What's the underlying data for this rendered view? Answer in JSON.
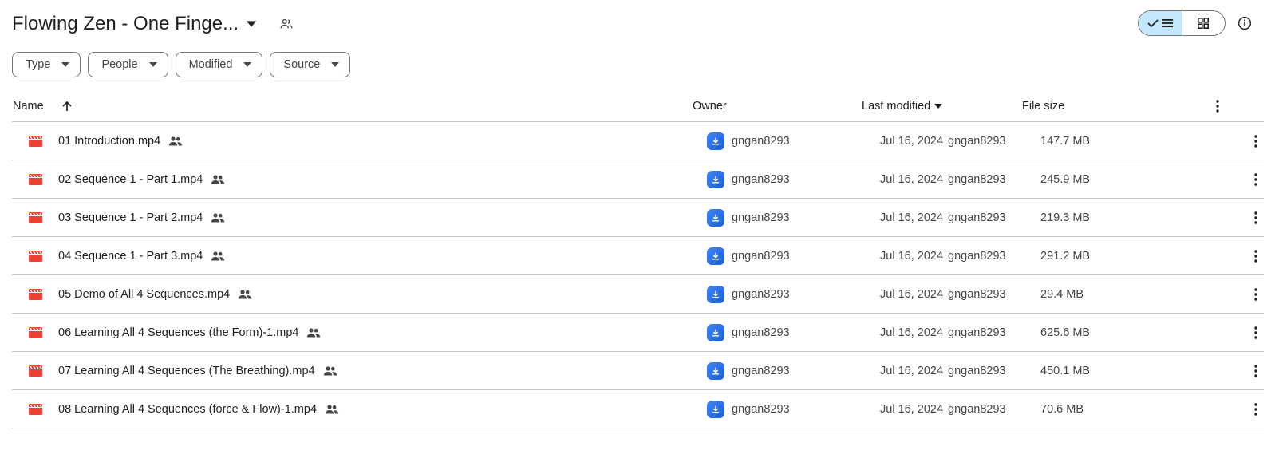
{
  "folder": {
    "title": "Flowing Zen - One Finge..."
  },
  "filters": [
    {
      "label": "Type"
    },
    {
      "label": "People"
    },
    {
      "label": "Modified"
    },
    {
      "label": "Source"
    }
  ],
  "table": {
    "columns": {
      "name": "Name",
      "owner": "Owner",
      "last_modified": "Last modified",
      "file_size": "File size"
    },
    "rows": [
      {
        "name": "01 Introduction.mp4",
        "owner": "gngan8293",
        "date": "Jul 16, 2024",
        "modified_by": "gngan8293",
        "size": "147.7 MB"
      },
      {
        "name": "02 Sequence 1 - Part 1.mp4",
        "owner": "gngan8293",
        "date": "Jul 16, 2024",
        "modified_by": "gngan8293",
        "size": "245.9 MB"
      },
      {
        "name": "03 Sequence 1 - Part 2.mp4",
        "owner": "gngan8293",
        "date": "Jul 16, 2024",
        "modified_by": "gngan8293",
        "size": "219.3 MB"
      },
      {
        "name": "04 Sequence 1 - Part 3.mp4",
        "owner": "gngan8293",
        "date": "Jul 16, 2024",
        "modified_by": "gngan8293",
        "size": "291.2 MB"
      },
      {
        "name": "05 Demo of All 4 Sequences.mp4",
        "owner": "gngan8293",
        "date": "Jul 16, 2024",
        "modified_by": "gngan8293",
        "size": "29.4 MB"
      },
      {
        "name": "06 Learning All 4 Sequences (the Form)-1.mp4",
        "owner": "gngan8293",
        "date": "Jul 16, 2024",
        "modified_by": "gngan8293",
        "size": "625.6 MB"
      },
      {
        "name": "07 Learning All 4 Sequences (The Breathing).mp4",
        "owner": "gngan8293",
        "date": "Jul 16, 2024",
        "modified_by": "gngan8293",
        "size": "450.1 MB"
      },
      {
        "name": "08 Learning All 4 Sequences (force & Flow)-1.mp4",
        "owner": "gngan8293",
        "date": "Jul 16, 2024",
        "modified_by": "gngan8293",
        "size": "70.6 MB"
      }
    ]
  },
  "icons": {
    "file": "video-file-icon",
    "shared": "shared-people-icon",
    "owner_avatar": "download-avatar-icon"
  },
  "colors": {
    "video_icon": "#ea4335",
    "toggle_active": "#c2e7ff",
    "avatar": "#4285f4"
  }
}
